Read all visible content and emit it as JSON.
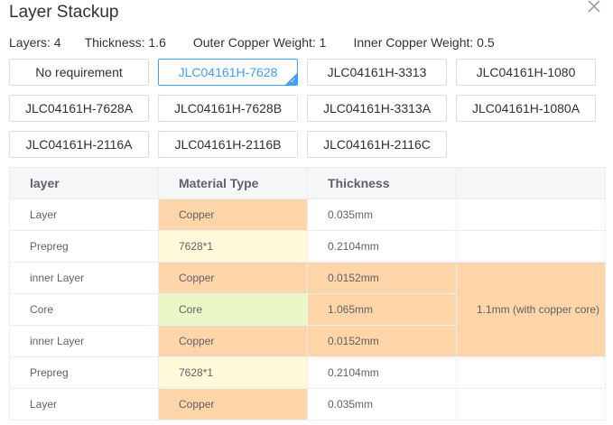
{
  "dialog": {
    "title": "Layer Stackup"
  },
  "summary": [
    "Layers: 4",
    "Thickness: 1.6",
    "Outer Copper Weight: 1",
    "Inner Copper Weight: 0.5"
  ],
  "options": [
    {
      "label": "No requirement",
      "selected": false
    },
    {
      "label": "JLC04161H-7628",
      "selected": true
    },
    {
      "label": "JLC04161H-3313",
      "selected": false
    },
    {
      "label": "JLC04161H-1080",
      "selected": false
    },
    {
      "label": "JLC04161H-7628A",
      "selected": false
    },
    {
      "label": "JLC04161H-7628B",
      "selected": false
    },
    {
      "label": "JLC04161H-3313A",
      "selected": false
    },
    {
      "label": "JLC04161H-1080A",
      "selected": false
    },
    {
      "label": "JLC04161H-2116A",
      "selected": false
    },
    {
      "label": "JLC04161H-2116B",
      "selected": false
    },
    {
      "label": "JLC04161H-2116C",
      "selected": false
    }
  ],
  "table": {
    "headers": [
      "layer",
      "Material Type",
      "Thickness",
      ""
    ],
    "rows": [
      {
        "layer": "Layer",
        "material": "Copper",
        "thickness": "0.035mm"
      },
      {
        "layer": "Prepreg",
        "material": "7628*1",
        "thickness": "0.2104mm"
      },
      {
        "layer": "inner Layer",
        "material": "Copper",
        "thickness": "0.0152mm"
      },
      {
        "layer": "Core",
        "material": "Core",
        "thickness": "1.065mm"
      },
      {
        "layer": "inner Layer",
        "material": "Copper",
        "thickness": "0.0152mm"
      },
      {
        "layer": "Prepreg",
        "material": "7628*1",
        "thickness": "0.2104mm"
      },
      {
        "layer": "Layer",
        "material": "Copper",
        "thickness": "0.035mm"
      }
    ],
    "core_note": "1.1mm (with copper core)"
  },
  "colors": {
    "accent": "#409eff",
    "copper": "#fdd5a9",
    "prepreg": "#fef9d8",
    "core": "#ebf7c7",
    "header_bg": "#f5f6f8"
  }
}
